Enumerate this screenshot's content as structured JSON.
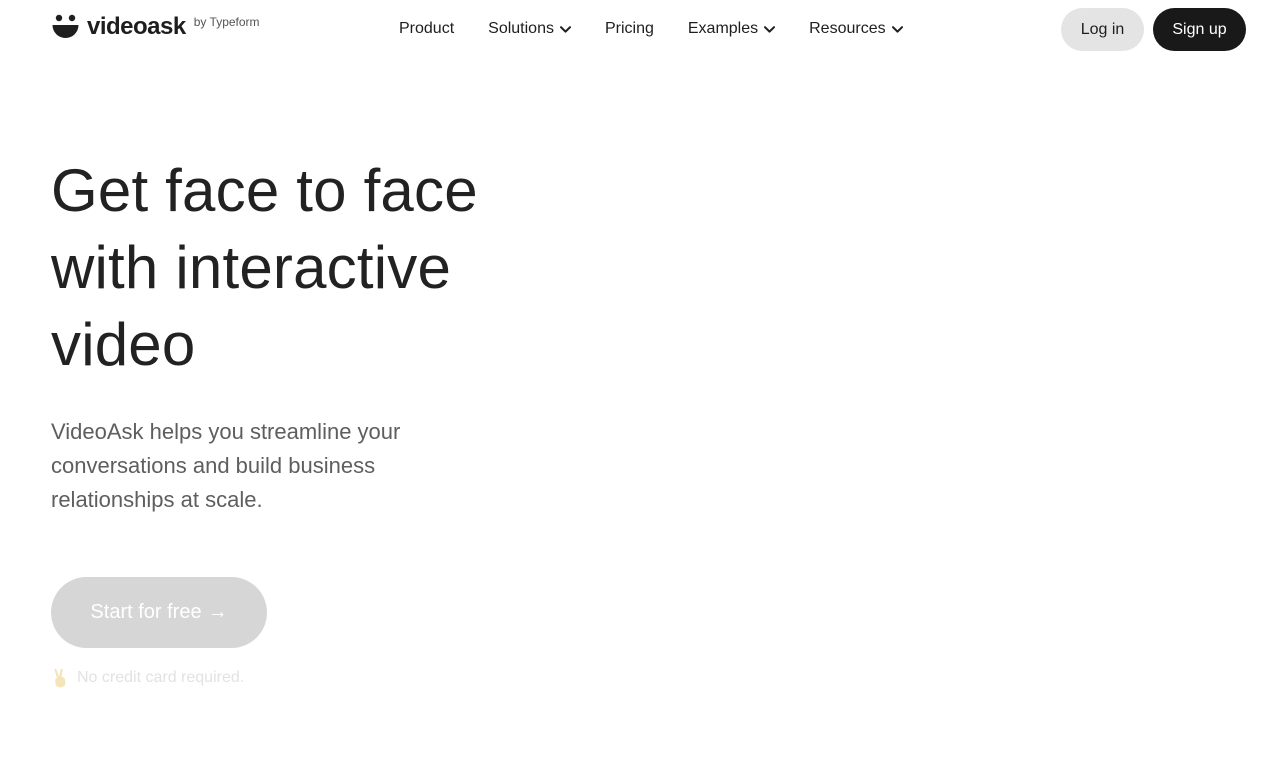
{
  "brand": {
    "name": "videoask",
    "byline": "by Typeform",
    "logo_icon": "smiley-face-icon"
  },
  "nav": {
    "items": [
      {
        "label": "Product",
        "has_dropdown": false
      },
      {
        "label": "Solutions",
        "has_dropdown": true
      },
      {
        "label": "Pricing",
        "has_dropdown": false
      },
      {
        "label": "Examples",
        "has_dropdown": true
      },
      {
        "label": "Resources",
        "has_dropdown": true
      }
    ],
    "login_label": "Log in",
    "signup_label": "Sign up"
  },
  "hero": {
    "title_lines": [
      "Get face to face",
      "with interactive",
      "video"
    ],
    "subtitle_lines": [
      "VideoAsk helps you streamline your",
      "conversations and build business",
      "relationships at scale."
    ],
    "cta_label": "Start for free",
    "cta_arrow": "→",
    "note_icon": "victory-hand-icon",
    "note_text": "No credit card required."
  },
  "colors": {
    "text_dark": "#1e1e1e",
    "subtitle": "#5e5e5e",
    "login_bg": "#e4e4e4",
    "signup_bg": "#191919",
    "cta_bg": "#d6d6d6"
  }
}
